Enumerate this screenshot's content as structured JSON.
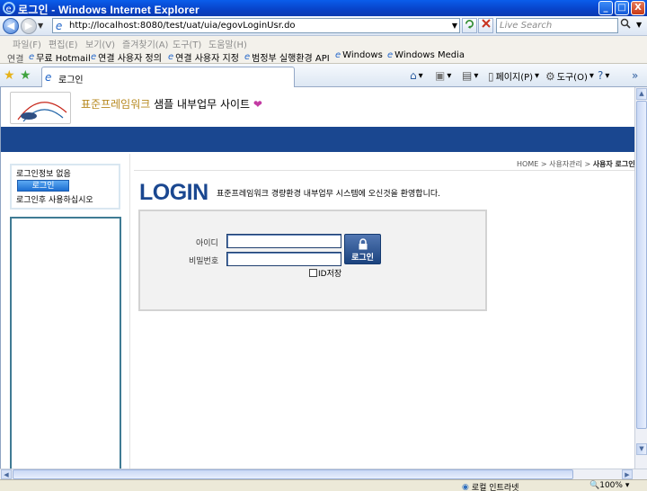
{
  "window": {
    "title": "로그인 - Windows Internet Explorer",
    "min": "_",
    "max": "□",
    "close": "X"
  },
  "address": {
    "url": "http://localhost:8080/test/uat/uia/egovLoginUsr.do",
    "search_placeholder": "Live Search"
  },
  "menu": [
    "파일(F)",
    "편집(E)",
    "보기(V)",
    "즐겨찾기(A)",
    "도구(T)",
    "도움말(H)"
  ],
  "links": {
    "label": "연결",
    "items": [
      "무료 Hotmail",
      "연결 사용자 정의",
      "연결 사용자 지정",
      "범정부 실행환경 API",
      "Windows",
      "Windows Media"
    ]
  },
  "tab": {
    "label": "로그인"
  },
  "commands": {
    "page": "페이지(P)",
    "tools": "도구(O)"
  },
  "statusbar": {
    "zone": "로컬 인트라넷",
    "zoom": "100%"
  },
  "page": {
    "logo_text": "전자정부 표준프레임워크",
    "site_title_accent": "표준프레임워크",
    "site_title_rest": " 샘플 내부업무 사이트",
    "left": {
      "no_login": "로그인정보 없음",
      "login_button": "로그인",
      "after_login": "로그인후 사용하십시오"
    },
    "breadcrumb": {
      "home": "HOME",
      "sep": ">",
      "section": "사용자관리",
      "current": "사용자 로그인"
    },
    "login_title": "LOGIN",
    "welcome": "표준프레임워크 경량환경 내부업무 시스템에 오신것을 환영합니다.",
    "form": {
      "id_label": "아이디",
      "pw_label": "비밀번호",
      "id_value": "",
      "pw_value": "",
      "login_button": "로그인",
      "save_id": "ID저장"
    }
  }
}
